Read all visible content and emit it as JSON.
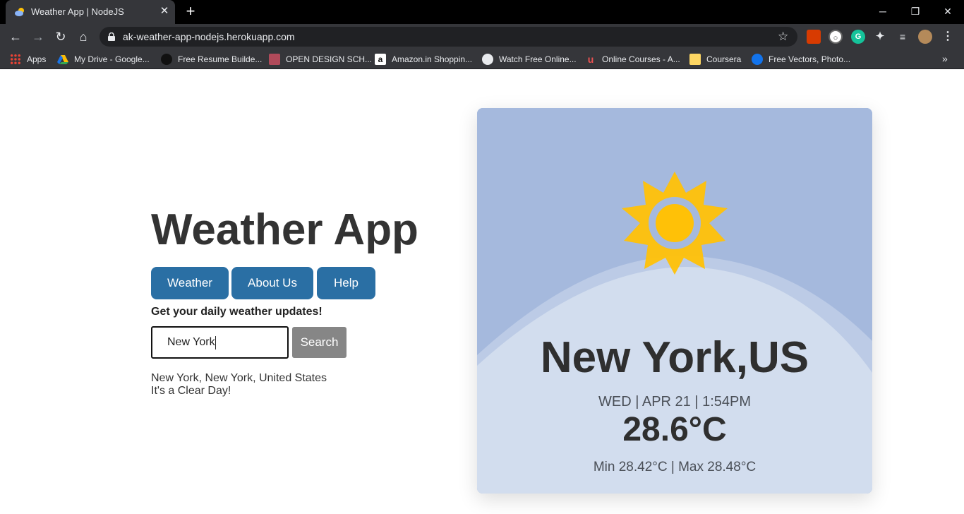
{
  "browser": {
    "tab_title": "Weather App | NodeJS",
    "url": "ak-weather-app-nodejs.herokuapp.com",
    "bookmarks": [
      {
        "label": "Apps",
        "icon": "apps-grid-icon"
      },
      {
        "label": "My Drive - Google...",
        "icon": "google-drive-icon"
      },
      {
        "label": "Free Resume Builde...",
        "icon": "resume-icon"
      },
      {
        "label": "OPEN DESIGN SCH...",
        "icon": "design-school-icon"
      },
      {
        "label": "Amazon.in Shoppin...",
        "icon": "amazon-icon"
      },
      {
        "label": "Watch Free Online...",
        "icon": "globe-icon"
      },
      {
        "label": "Online Courses - A...",
        "icon": "udemy-icon"
      },
      {
        "label": "Coursera",
        "icon": "folder-icon"
      },
      {
        "label": "Free Vectors, Photo...",
        "icon": "freepik-icon"
      }
    ]
  },
  "app": {
    "title": "Weather App",
    "nav": [
      {
        "label": "Weather"
      },
      {
        "label": "About Us"
      },
      {
        "label": "Help"
      }
    ],
    "tagline": "Get your daily weather updates!",
    "search": {
      "value": "New York",
      "button_label": "Search"
    },
    "result": {
      "location": "New York, New York, United States",
      "forecast": "It's a Clear Day!"
    }
  },
  "card": {
    "icon": "sun-icon",
    "city": "New York,US",
    "datetime": "WED | APR 21 | 1:54PM",
    "temperature": "28.6°C",
    "min_max": "Min 28.42°C | Max 28.48°C"
  },
  "colors": {
    "nav_button": "#2a6fa4",
    "search_button": "#868686",
    "card_sky": "#a5b9dd",
    "card_ground": "#d2ddee",
    "sun": "#ffc107"
  }
}
